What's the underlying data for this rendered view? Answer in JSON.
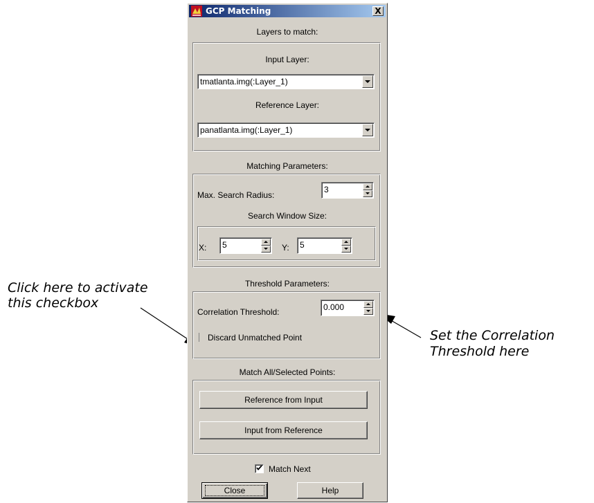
{
  "annotations": {
    "left_line1": "Click here to activate",
    "left_line2": "this checkbox",
    "right_line1": "Set the Correlation",
    "right_line2": "Threshold here"
  },
  "dialog": {
    "title": "GCP Matching",
    "close_glyph": "X",
    "layers_section": "Layers to match:",
    "input_layer_label": "Input Layer:",
    "input_layer_value": "tmatlanta.img(:Layer_1)",
    "reference_layer_label": "Reference Layer:",
    "reference_layer_value": "panatlanta.img(:Layer_1)",
    "matching_section": "Matching Parameters:",
    "max_search_radius_label": "Max. Search Radius:",
    "max_search_radius_value": "3",
    "search_window_label": "Search Window Size:",
    "x_label": "X:",
    "x_value": "5",
    "y_label": "Y:",
    "y_value": "5",
    "threshold_section": "Threshold Parameters:",
    "correlation_label": "Correlation Threshold:",
    "correlation_value": "0.000",
    "discard_label": "Discard Unmatched Point",
    "match_section": "Match All/Selected Points:",
    "reference_from_input": "Reference from Input",
    "input_from_reference": "Input from Reference",
    "match_next_label": "Match Next",
    "close_button": "Close",
    "help_button": "Help"
  },
  "state": {
    "discard_checked": false,
    "match_next_checked": true
  },
  "colors": {
    "dialog_bg": "#d4d0c8",
    "title_start": "#0a246a",
    "title_end": "#a6caf0"
  },
  "icons": [
    "app-icon",
    "close-icon",
    "dropdown-arrow-icon",
    "spin-up-icon",
    "spin-down-icon",
    "check-icon",
    "arrow-icon"
  ]
}
